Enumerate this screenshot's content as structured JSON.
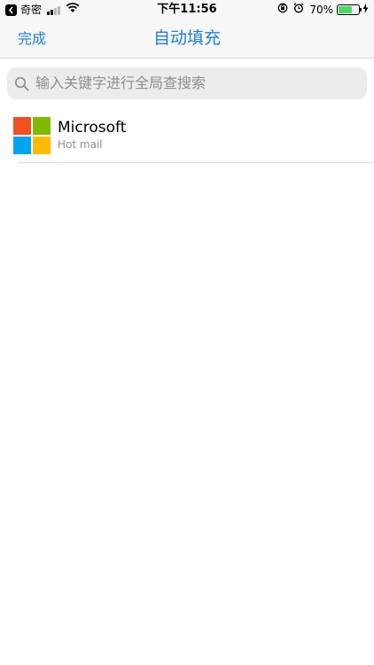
{
  "status_bar": {
    "back_app": "奇密",
    "time": "下午11:56",
    "battery_percent": "70%",
    "battery_level": 0.7,
    "battery_color": "#4cd964"
  },
  "nav": {
    "done_label": "完成",
    "title": "自动填充",
    "accent_color": "#1d7fd6"
  },
  "search": {
    "placeholder": "输入关键字进行全局查搜索",
    "icon": "search-icon"
  },
  "items": [
    {
      "title": "Microsoft",
      "subtitle": "Hot mail",
      "icon": "microsoft-logo",
      "logo_colors": [
        "#f25022",
        "#7fba00",
        "#00a4ef",
        "#ffb900"
      ]
    }
  ]
}
